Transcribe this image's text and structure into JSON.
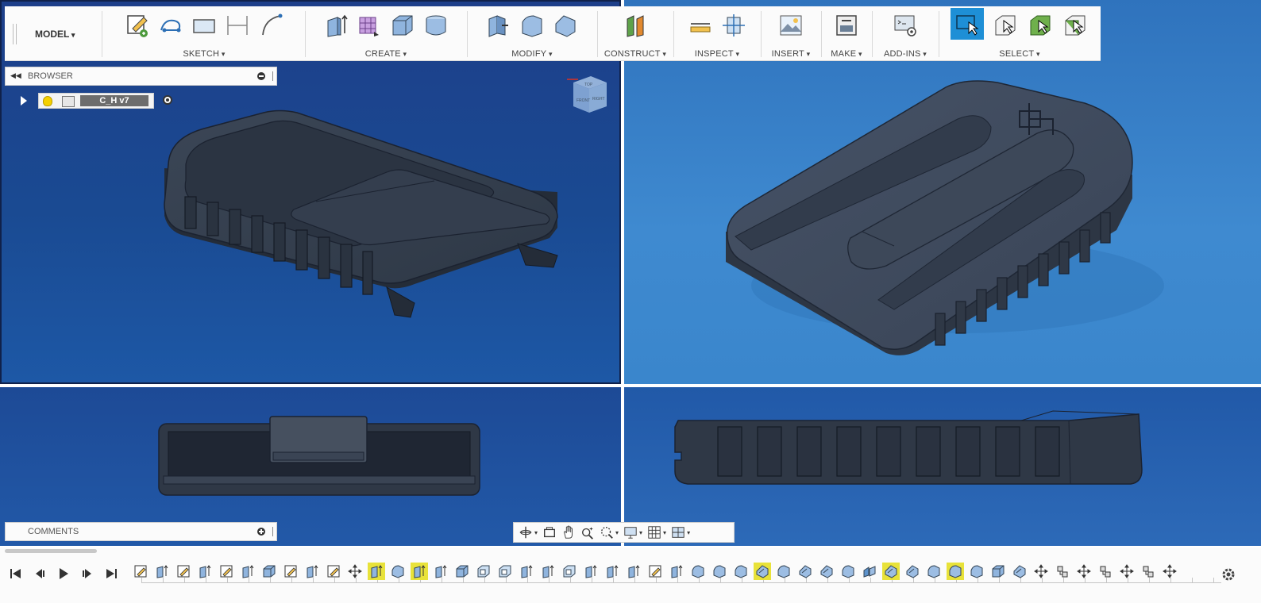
{
  "toolbar": {
    "workspace": "MODEL",
    "groups": [
      {
        "label": "SKETCH",
        "icons": [
          "create-sketch-icon",
          "line-icon",
          "rectangle-icon",
          "dimension-icon",
          "arc-icon"
        ]
      },
      {
        "label": "CREATE",
        "icons": [
          "extrude-icon",
          "form-icon",
          "box-icon",
          "cylinder-icon"
        ]
      },
      {
        "label": "MODIFY",
        "icons": [
          "press-pull-icon",
          "fillet-icon",
          "chamfer-icon"
        ]
      },
      {
        "label": "CONSTRUCT",
        "icons": [
          "offset-plane-icon"
        ]
      },
      {
        "label": "INSPECT",
        "icons": [
          "measure-icon",
          "section-analysis-icon"
        ]
      },
      {
        "label": "INSERT",
        "icons": [
          "insert-image-icon"
        ]
      },
      {
        "label": "MAKE",
        "icons": [
          "3d-print-icon"
        ]
      },
      {
        "label": "ADD-INS",
        "icons": [
          "scripts-icon"
        ]
      },
      {
        "label": "SELECT",
        "icons": [
          "select-icon",
          "window-select-icon",
          "freeform-select-icon",
          "paint-select-icon"
        ]
      }
    ]
  },
  "browser": {
    "title": "BROWSER",
    "component": "C_H v7"
  },
  "comments": {
    "title": "COMMENTS"
  },
  "viewcube": {
    "faces": [
      "TOP",
      "FRONT",
      "RIGHT"
    ]
  },
  "navbar": {
    "items": [
      "orbit-icon",
      "look-at-icon",
      "pan-icon",
      "zoom-icon",
      "fit-icon",
      "display-settings-icon",
      "grid-icon",
      "viewports-icon"
    ]
  },
  "timeline": {
    "features": [
      {
        "type": "sketch",
        "hl": false
      },
      {
        "type": "extrude",
        "hl": false
      },
      {
        "type": "sketch",
        "hl": false
      },
      {
        "type": "extrude",
        "hl": false
      },
      {
        "type": "sketch",
        "hl": false
      },
      {
        "type": "extrude",
        "hl": false
      },
      {
        "type": "body",
        "hl": false
      },
      {
        "type": "sketch",
        "hl": false
      },
      {
        "type": "extrude",
        "hl": false
      },
      {
        "type": "sketch",
        "hl": false
      },
      {
        "type": "move",
        "hl": false
      },
      {
        "type": "extrude",
        "hl": true
      },
      {
        "type": "fillet",
        "hl": false
      },
      {
        "type": "extrude",
        "hl": true
      },
      {
        "type": "extrude",
        "hl": false
      },
      {
        "type": "body",
        "hl": false
      },
      {
        "type": "shell",
        "hl": false
      },
      {
        "type": "shell",
        "hl": false
      },
      {
        "type": "extrude",
        "hl": false
      },
      {
        "type": "extrude",
        "hl": false
      },
      {
        "type": "shell",
        "hl": false
      },
      {
        "type": "extrude",
        "hl": false
      },
      {
        "type": "extrude",
        "hl": false
      },
      {
        "type": "extrude",
        "hl": false
      },
      {
        "type": "sketch",
        "hl": false
      },
      {
        "type": "extrude",
        "hl": false
      },
      {
        "type": "fillet",
        "hl": false
      },
      {
        "type": "fillet",
        "hl": false
      },
      {
        "type": "fillet",
        "hl": false
      },
      {
        "type": "chamfer",
        "hl": true
      },
      {
        "type": "fillet",
        "hl": false
      },
      {
        "type": "chamfer",
        "hl": false
      },
      {
        "type": "chamfer",
        "hl": false
      },
      {
        "type": "fillet",
        "hl": false
      },
      {
        "type": "split",
        "hl": false
      },
      {
        "type": "chamfer",
        "hl": true
      },
      {
        "type": "chamfer",
        "hl": false
      },
      {
        "type": "fillet",
        "hl": false
      },
      {
        "type": "fillet",
        "hl": true
      },
      {
        "type": "fillet",
        "hl": false
      },
      {
        "type": "body",
        "hl": false
      },
      {
        "type": "chamfer",
        "hl": false
      },
      {
        "type": "move",
        "hl": false
      },
      {
        "type": "joint",
        "hl": false
      },
      {
        "type": "move",
        "hl": false
      },
      {
        "type": "joint",
        "hl": false
      },
      {
        "type": "move",
        "hl": false
      },
      {
        "type": "joint",
        "hl": false
      },
      {
        "type": "move",
        "hl": false
      }
    ]
  },
  "colors": {
    "accent": "#1e8fd6",
    "highlight": "#e8e23a",
    "viewport_dark": "#1d3f8a",
    "viewport_light": "#3f8ad0",
    "part": "#3e4a5c"
  }
}
